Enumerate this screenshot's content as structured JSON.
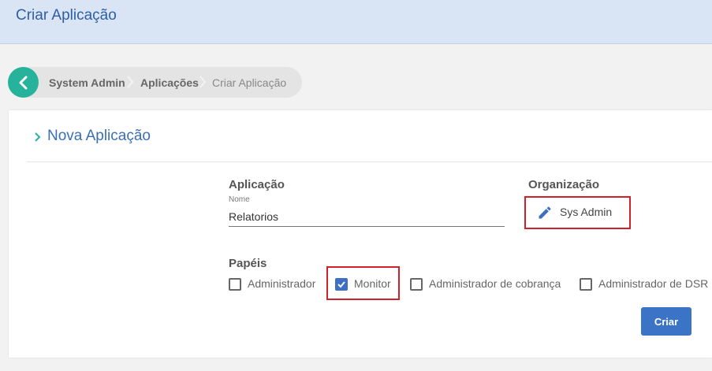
{
  "header": {
    "title": "Criar Aplicação"
  },
  "breadcrumb": {
    "items": [
      "System Admin",
      "Aplicações",
      "Criar Aplicação"
    ]
  },
  "form": {
    "section_title": "Nova Aplicação",
    "app_label": "Aplicação",
    "name_small_label": "Nome",
    "name_value": "Relatorios",
    "org_label": "Organização",
    "org_value": "Sys Admin",
    "roles_label": "Papéis",
    "roles": [
      {
        "label": "Administrador",
        "checked": false
      },
      {
        "label": "Monitor",
        "checked": true
      },
      {
        "label": "Administrador de cobrança",
        "checked": false
      },
      {
        "label": "Administrador de DSR",
        "checked": false
      }
    ],
    "submit_label": "Criar"
  },
  "colors": {
    "accent": "#3b74c6",
    "back_button": "#27b39b",
    "highlight": "#d1222a"
  }
}
